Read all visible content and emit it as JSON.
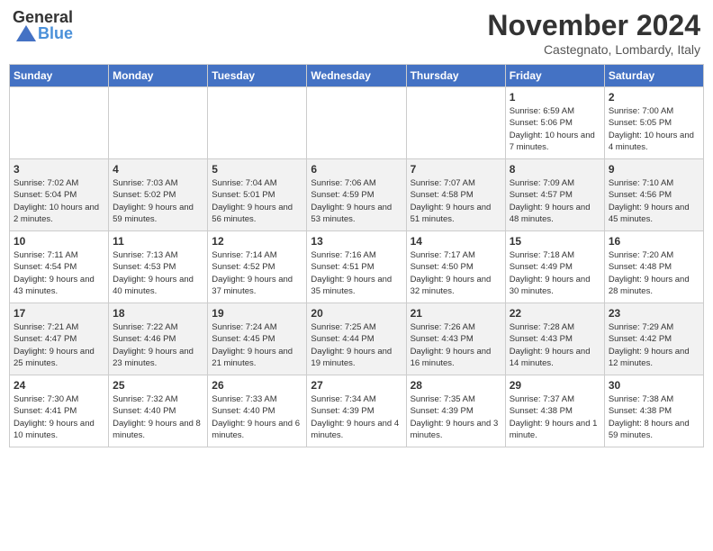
{
  "header": {
    "logo_general": "General",
    "logo_blue": "Blue",
    "month": "November 2024",
    "location": "Castegnato, Lombardy, Italy"
  },
  "days_of_week": [
    "Sunday",
    "Monday",
    "Tuesday",
    "Wednesday",
    "Thursday",
    "Friday",
    "Saturday"
  ],
  "weeks": [
    [
      {
        "day": "",
        "info": ""
      },
      {
        "day": "",
        "info": ""
      },
      {
        "day": "",
        "info": ""
      },
      {
        "day": "",
        "info": ""
      },
      {
        "day": "",
        "info": ""
      },
      {
        "day": "1",
        "info": "Sunrise: 6:59 AM\nSunset: 5:06 PM\nDaylight: 10 hours and 7 minutes."
      },
      {
        "day": "2",
        "info": "Sunrise: 7:00 AM\nSunset: 5:05 PM\nDaylight: 10 hours and 4 minutes."
      }
    ],
    [
      {
        "day": "3",
        "info": "Sunrise: 7:02 AM\nSunset: 5:04 PM\nDaylight: 10 hours and 2 minutes."
      },
      {
        "day": "4",
        "info": "Sunrise: 7:03 AM\nSunset: 5:02 PM\nDaylight: 9 hours and 59 minutes."
      },
      {
        "day": "5",
        "info": "Sunrise: 7:04 AM\nSunset: 5:01 PM\nDaylight: 9 hours and 56 minutes."
      },
      {
        "day": "6",
        "info": "Sunrise: 7:06 AM\nSunset: 4:59 PM\nDaylight: 9 hours and 53 minutes."
      },
      {
        "day": "7",
        "info": "Sunrise: 7:07 AM\nSunset: 4:58 PM\nDaylight: 9 hours and 51 minutes."
      },
      {
        "day": "8",
        "info": "Sunrise: 7:09 AM\nSunset: 4:57 PM\nDaylight: 9 hours and 48 minutes."
      },
      {
        "day": "9",
        "info": "Sunrise: 7:10 AM\nSunset: 4:56 PM\nDaylight: 9 hours and 45 minutes."
      }
    ],
    [
      {
        "day": "10",
        "info": "Sunrise: 7:11 AM\nSunset: 4:54 PM\nDaylight: 9 hours and 43 minutes."
      },
      {
        "day": "11",
        "info": "Sunrise: 7:13 AM\nSunset: 4:53 PM\nDaylight: 9 hours and 40 minutes."
      },
      {
        "day": "12",
        "info": "Sunrise: 7:14 AM\nSunset: 4:52 PM\nDaylight: 9 hours and 37 minutes."
      },
      {
        "day": "13",
        "info": "Sunrise: 7:16 AM\nSunset: 4:51 PM\nDaylight: 9 hours and 35 minutes."
      },
      {
        "day": "14",
        "info": "Sunrise: 7:17 AM\nSunset: 4:50 PM\nDaylight: 9 hours and 32 minutes."
      },
      {
        "day": "15",
        "info": "Sunrise: 7:18 AM\nSunset: 4:49 PM\nDaylight: 9 hours and 30 minutes."
      },
      {
        "day": "16",
        "info": "Sunrise: 7:20 AM\nSunset: 4:48 PM\nDaylight: 9 hours and 28 minutes."
      }
    ],
    [
      {
        "day": "17",
        "info": "Sunrise: 7:21 AM\nSunset: 4:47 PM\nDaylight: 9 hours and 25 minutes."
      },
      {
        "day": "18",
        "info": "Sunrise: 7:22 AM\nSunset: 4:46 PM\nDaylight: 9 hours and 23 minutes."
      },
      {
        "day": "19",
        "info": "Sunrise: 7:24 AM\nSunset: 4:45 PM\nDaylight: 9 hours and 21 minutes."
      },
      {
        "day": "20",
        "info": "Sunrise: 7:25 AM\nSunset: 4:44 PM\nDaylight: 9 hours and 19 minutes."
      },
      {
        "day": "21",
        "info": "Sunrise: 7:26 AM\nSunset: 4:43 PM\nDaylight: 9 hours and 16 minutes."
      },
      {
        "day": "22",
        "info": "Sunrise: 7:28 AM\nSunset: 4:43 PM\nDaylight: 9 hours and 14 minutes."
      },
      {
        "day": "23",
        "info": "Sunrise: 7:29 AM\nSunset: 4:42 PM\nDaylight: 9 hours and 12 minutes."
      }
    ],
    [
      {
        "day": "24",
        "info": "Sunrise: 7:30 AM\nSunset: 4:41 PM\nDaylight: 9 hours and 10 minutes."
      },
      {
        "day": "25",
        "info": "Sunrise: 7:32 AM\nSunset: 4:40 PM\nDaylight: 9 hours and 8 minutes."
      },
      {
        "day": "26",
        "info": "Sunrise: 7:33 AM\nSunset: 4:40 PM\nDaylight: 9 hours and 6 minutes."
      },
      {
        "day": "27",
        "info": "Sunrise: 7:34 AM\nSunset: 4:39 PM\nDaylight: 9 hours and 4 minutes."
      },
      {
        "day": "28",
        "info": "Sunrise: 7:35 AM\nSunset: 4:39 PM\nDaylight: 9 hours and 3 minutes."
      },
      {
        "day": "29",
        "info": "Sunrise: 7:37 AM\nSunset: 4:38 PM\nDaylight: 9 hours and 1 minute."
      },
      {
        "day": "30",
        "info": "Sunrise: 7:38 AM\nSunset: 4:38 PM\nDaylight: 8 hours and 59 minutes."
      }
    ]
  ]
}
